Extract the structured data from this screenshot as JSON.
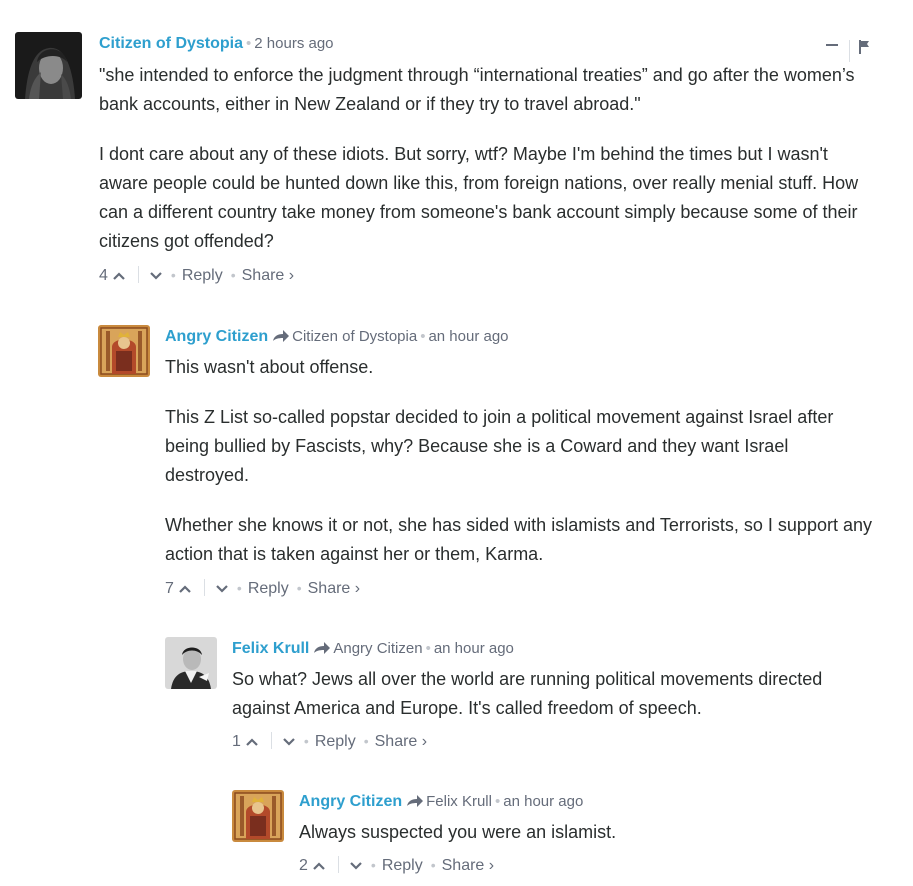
{
  "comments": [
    {
      "author": "Citizen of Dystopia",
      "parent": "",
      "time": "2 hours ago",
      "paragraphs": [
        "\"she intended to enforce the judgment through “international treaties” and go after the women’s bank accounts, either in New Zealand or if they try to travel abroad.\"",
        "I dont care about any of these idiots. But sorry, wtf? Maybe I'm behind the times but I wasn't aware people could be hunted down like this, from foreign nations, over really menial stuff. How can a different country take money from someone's bank account simply because some of their citizens got offended?"
      ],
      "upvotes": "4",
      "reply_label": "Reply",
      "share_label": "Share ›"
    },
    {
      "author": "Angry Citizen",
      "parent": "Citizen of Dystopia",
      "time": "an hour ago",
      "paragraphs": [
        "This wasn't about offense.",
        "This Z List so-called popstar decided to join a political movement against Israel after being bullied by Fascists, why? Because she is a Coward and they want Israel destroyed.",
        "Whether she knows it or not, she has sided with islamists and Terrorists, so I support any action that is taken against her or them, Karma."
      ],
      "upvotes": "7",
      "reply_label": "Reply",
      "share_label": "Share ›"
    },
    {
      "author": "Felix Krull",
      "parent": "Angry Citizen",
      "time": "an hour ago",
      "paragraphs": [
        "So what? Jews all over the world are running political movements directed against America and Europe. It's called freedom of speech."
      ],
      "upvotes": "1",
      "reply_label": "Reply",
      "share_label": "Share ›"
    },
    {
      "author": "Angry Citizen",
      "parent": "Felix Krull",
      "time": "an hour ago",
      "paragraphs": [
        "Always suspected you were an islamist."
      ],
      "upvotes": "2",
      "reply_label": "Reply",
      "share_label": "Share ›"
    }
  ],
  "colors": {
    "author": "#2e9fce",
    "meta": "#656c7a",
    "text": "#2a2e2e",
    "divider": "#dbdfe4"
  },
  "icons": {
    "reply_indicator": "reply-arrow-icon",
    "upvote": "chevron-up-icon",
    "downvote": "chevron-down-icon",
    "collapse": "minus-icon",
    "flag": "flag-icon"
  }
}
